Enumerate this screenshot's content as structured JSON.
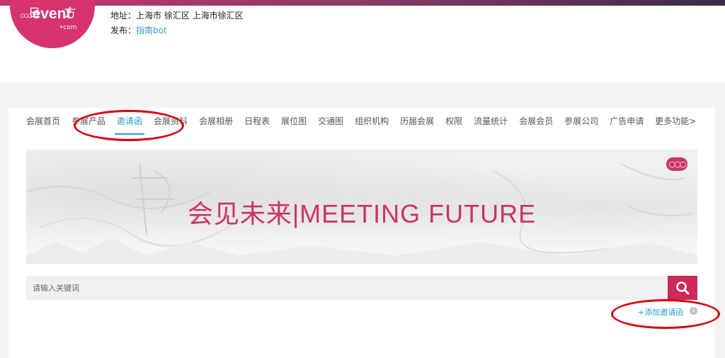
{
  "brand": {
    "logo_top": "日 方",
    "logo_dots": "○○○",
    "logo_text": "event",
    "logo_sub": "•com",
    "accent_color": "#cc3366"
  },
  "header": {
    "address_label": "地址：",
    "address_value": "上海市 徐汇区 上海市徐汇区",
    "publisher_label": "发布：",
    "publisher_value": "指南bot"
  },
  "nav": {
    "items": [
      "会展首页",
      "参展产品",
      "邀请函",
      "会展资料",
      "会展相册",
      "日程表",
      "展位图",
      "交通图",
      "组织机构",
      "历届会展",
      "权限",
      "流量统计",
      "会展会员",
      "参展公司",
      "广告申请",
      "更多功能>"
    ],
    "active_index": 2
  },
  "banner": {
    "text": "会见未来|MEETING FUTURE",
    "logo": "○○○"
  },
  "search": {
    "placeholder": "请输入关键词",
    "button_icon": "search-icon"
  },
  "actions": {
    "add_invitation": "+添加邀请函",
    "info_icon": "i"
  },
  "annotations": {
    "color": "#e0000f"
  }
}
